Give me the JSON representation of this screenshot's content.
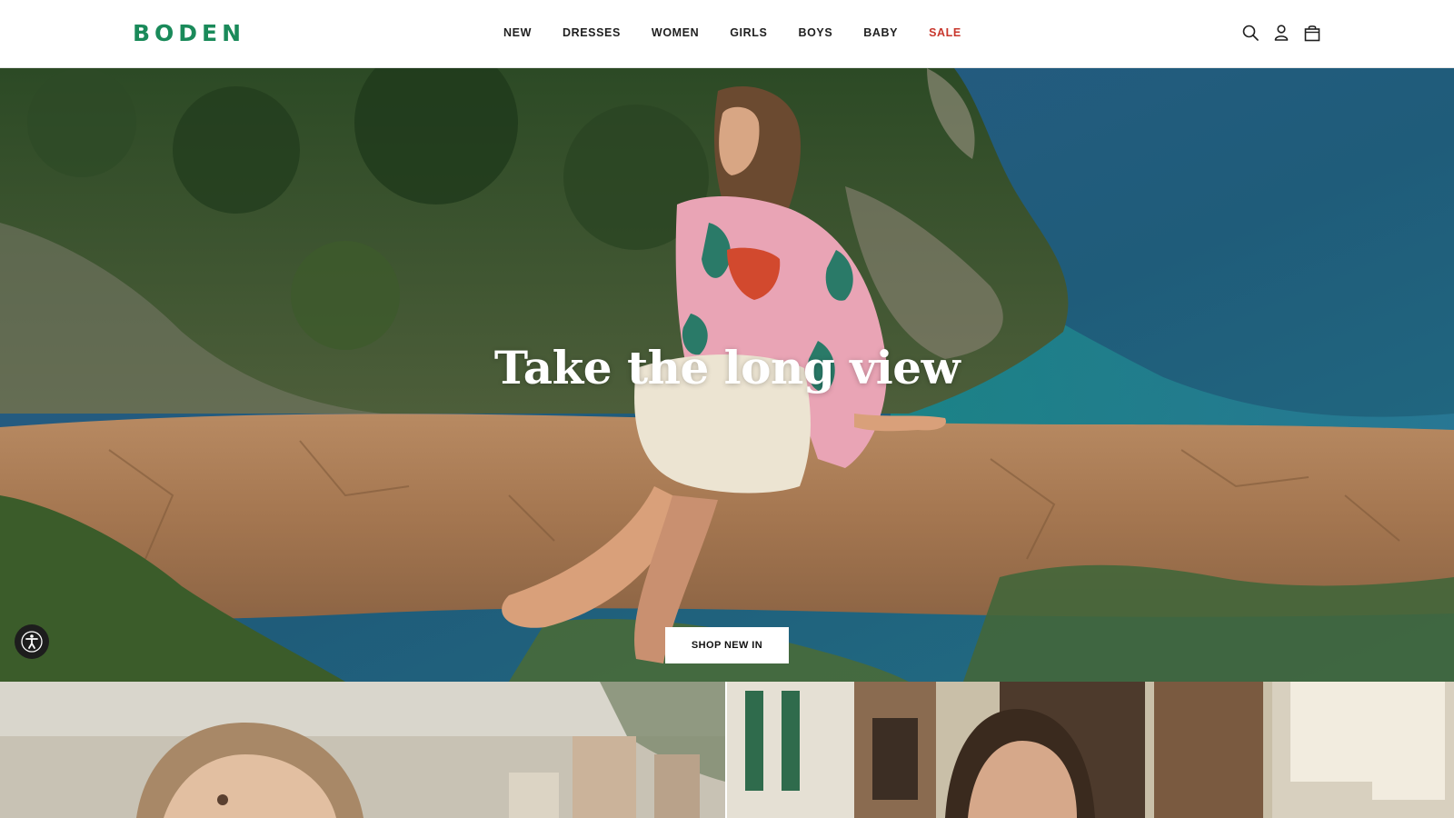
{
  "brand": {
    "name": "BODEN",
    "color": "#1a8a5a"
  },
  "nav": {
    "items": [
      {
        "label": "NEW"
      },
      {
        "label": "DRESSES"
      },
      {
        "label": "WOMEN"
      },
      {
        "label": "GIRLS"
      },
      {
        "label": "BOYS"
      },
      {
        "label": "BABY"
      },
      {
        "label": "SALE",
        "color": "#c8372d"
      }
    ]
  },
  "header_icons": [
    "search-icon",
    "account-icon",
    "bag-icon"
  ],
  "hero": {
    "title": "Take the long view",
    "cta_label": "SHOP NEW IN"
  },
  "accessibility": {
    "icon": "accessibility-icon"
  }
}
